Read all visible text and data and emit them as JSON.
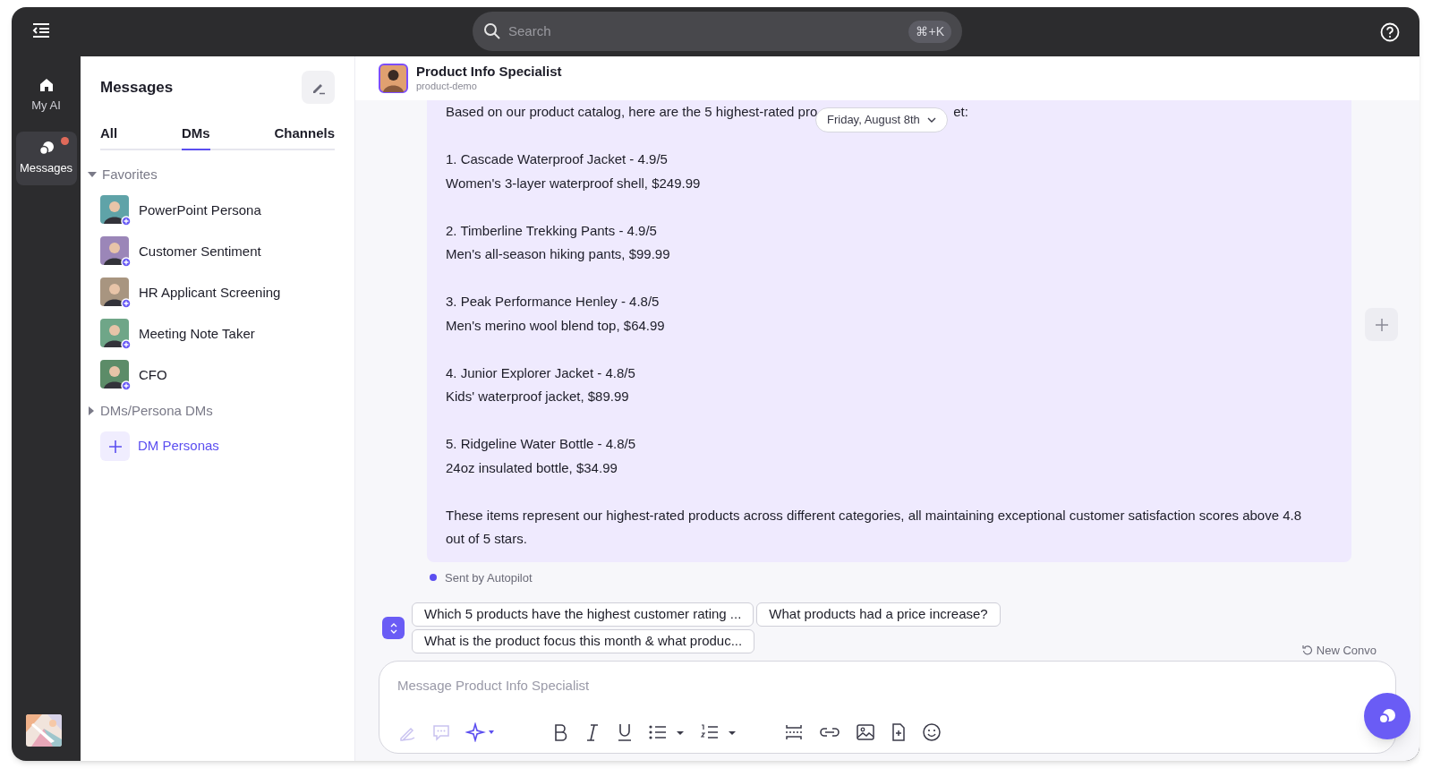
{
  "topbar": {
    "search": {
      "placeholder": "Search",
      "shortcut": "⌘+K"
    }
  },
  "rail": [
    {
      "label": "My AI",
      "kind": "home",
      "selected": false,
      "notification": false
    },
    {
      "label": "Messages",
      "kind": "chat",
      "selected": true,
      "notification": true
    }
  ],
  "sidebar": {
    "title": "Messages",
    "tabs": [
      {
        "label": "All",
        "selected": false
      },
      {
        "label": "DMs",
        "selected": true
      },
      {
        "label": "Channels",
        "selected": false
      }
    ],
    "sections": [
      {
        "label": "Favorites",
        "expanded": true,
        "children": [
          {
            "name": "PowerPoint Persona",
            "color": "#5fa3a8"
          },
          {
            "name": "Customer Sentiment",
            "color": "#9b86b8"
          },
          {
            "name": "HR Applicant Screening",
            "color": "#a89580"
          },
          {
            "name": "Meeting Note Taker",
            "color": "#6fa688"
          },
          {
            "name": "CFO",
            "color": "#5c8c68"
          }
        ]
      },
      {
        "label": "DMs/Persona DMs",
        "expanded": false
      }
    ],
    "add_button": "DM Personas"
  },
  "chat": {
    "title": "Product Info Specialist",
    "subtitle": "product-demo",
    "date": "Friday, August 8th",
    "message": {
      "first_line_start": "Based on our product catalog, here are the 5 highest-rated pro",
      "first_line_end": "et:",
      "items": [
        [
          "1. Cascade Waterproof Jacket - 4.9/5",
          "Women's 3-layer waterproof shell, $249.99"
        ],
        [
          "2. Timberline Trekking Pants - 4.9/5",
          "Men's all-season hiking pants, $99.99"
        ],
        [
          "3. Peak Performance Henley - 4.8/5",
          "Men's merino wool blend top, $64.99"
        ],
        [
          "4. Junior Explorer Jacket - 4.8/5",
          "Kids' waterproof jacket, $89.99"
        ],
        [
          "5. Ridgeline Water Bottle - 4.8/5",
          "24oz insulated bottle, $34.99"
        ]
      ],
      "closing": "These items represent our highest-rated products across different categories, all maintaining exceptional customer satisfaction scores above 4.8 out of 5 stars."
    },
    "sender_note": "Sent by Autopilot",
    "suggestions": [
      "Which 5 products have the highest customer rating ...",
      "What products had a price increase?",
      "What is the product focus this month & what produc..."
    ],
    "new_convo": "New Convo",
    "composer": {
      "placeholder": "Message Product Info Specialist"
    }
  }
}
